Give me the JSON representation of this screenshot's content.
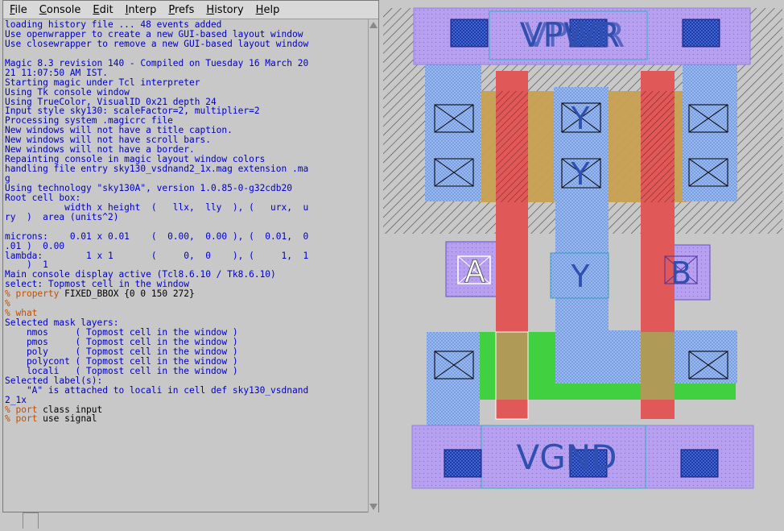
{
  "menubar": {
    "items": [
      {
        "label": "File",
        "accel": "F",
        "rest": "ile"
      },
      {
        "label": "Console",
        "accel": "C",
        "rest": "onsole"
      },
      {
        "label": "Edit",
        "accel": "E",
        "rest": "dit"
      },
      {
        "label": "Interp",
        "accel": "I",
        "rest": "nterp"
      },
      {
        "label": "Prefs",
        "accel": "P",
        "rest": "refs"
      },
      {
        "label": "History",
        "accel": "H",
        "rest": "istory"
      },
      {
        "label": "Help",
        "accel": "H",
        "rest": "elp"
      }
    ]
  },
  "console": {
    "lines": [
      {
        "t": "out",
        "text": "loading history file ... 48 events added"
      },
      {
        "t": "out",
        "text": "Use openwrapper to create a new GUI-based layout window"
      },
      {
        "t": "out",
        "text": "Use closewrapper to remove a new GUI-based layout window"
      },
      {
        "t": "out",
        "text": ""
      },
      {
        "t": "out",
        "text": "Magic 8.3 revision 140 - Compiled on Tuesday 16 March 20"
      },
      {
        "t": "out",
        "text": "21 11:07:50 AM IST."
      },
      {
        "t": "out",
        "text": "Starting magic under Tcl interpreter"
      },
      {
        "t": "out",
        "text": "Using Tk console window"
      },
      {
        "t": "out",
        "text": "Using TrueColor, VisualID 0x21 depth 24"
      },
      {
        "t": "out",
        "text": "Input style sky130: scaleFactor=2, multiplier=2"
      },
      {
        "t": "out",
        "text": "Processing system .magicrc file"
      },
      {
        "t": "out",
        "text": "New windows will not have a title caption."
      },
      {
        "t": "out",
        "text": "New windows will not have scroll bars."
      },
      {
        "t": "out",
        "text": "New windows will not have a border."
      },
      {
        "t": "out",
        "text": "Repainting console in magic layout window colors"
      },
      {
        "t": "out",
        "text": "handling file entry sky130_vsdnand2_1x.mag extension .ma"
      },
      {
        "t": "out",
        "text": "g"
      },
      {
        "t": "out",
        "text": "Using technology \"sky130A\", version 1.0.85-0-g32cdb20"
      },
      {
        "t": "out",
        "text": "Root cell box:"
      },
      {
        "t": "out",
        "text": "           width x height  (   llx,  lly  ), (   urx,  u"
      },
      {
        "t": "out",
        "text": "ry  )  area (units^2)"
      },
      {
        "t": "out",
        "text": ""
      },
      {
        "t": "out",
        "text": "microns:    0.01 x 0.01    (  0.00,  0.00 ), (  0.01,  0"
      },
      {
        "t": "out",
        "text": ".01 )  0.00"
      },
      {
        "t": "out",
        "text": "lambda:        1 x 1       (     0,  0    ), (     1,  1"
      },
      {
        "t": "out",
        "text": "    )  1"
      },
      {
        "t": "out",
        "text": "Main console display active (Tcl8.6.10 / Tk8.6.10)"
      },
      {
        "t": "out",
        "text": "select: Topmost cell in the window"
      },
      {
        "t": "cmd",
        "prompt": "% ",
        "cmd": "property",
        "args": " FIXED_BBOX {0 0 150 272}"
      },
      {
        "t": "cmd",
        "prompt": "%",
        "cmd": "",
        "args": ""
      },
      {
        "t": "cmd",
        "prompt": "% ",
        "cmd": "what",
        "args": ""
      },
      {
        "t": "out",
        "text": "Selected mask layers:"
      },
      {
        "t": "out",
        "text": "    nmos     ( Topmost cell in the window )"
      },
      {
        "t": "out",
        "text": "    pmos     ( Topmost cell in the window )"
      },
      {
        "t": "out",
        "text": "    poly     ( Topmost cell in the window )"
      },
      {
        "t": "out",
        "text": "    polycont ( Topmost cell in the window )"
      },
      {
        "t": "out",
        "text": "    locali   ( Topmost cell in the window )"
      },
      {
        "t": "out",
        "text": "Selected label(s):"
      },
      {
        "t": "out",
        "text": "    \"A\" is attached to locali in cell def sky130_vsdnand"
      },
      {
        "t": "out",
        "text": "2_1x"
      },
      {
        "t": "cmd",
        "prompt": "% ",
        "cmd": "port",
        "args": " class input"
      },
      {
        "t": "cmd",
        "prompt": "% ",
        "cmd": "port",
        "args": " use signal"
      }
    ]
  },
  "layout": {
    "labels": {
      "vpwr": "VPWR",
      "vgnd": "VGND",
      "a": "A",
      "b": "B",
      "y": "Y"
    },
    "colors": {
      "background": "#c8c8c8",
      "metal1": "#b8a8f0",
      "locali": "#98b8f0",
      "poly": "#e05858",
      "ndiff": "#40d040",
      "pdiff": "#c8a050",
      "nwell_hatch": "#404040",
      "label": "#3050b0"
    }
  }
}
